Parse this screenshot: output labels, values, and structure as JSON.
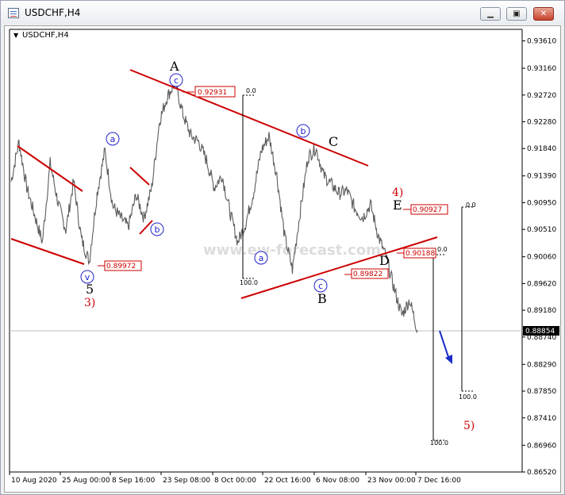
{
  "window": {
    "title": "USDCHF,H4"
  },
  "colors": {
    "wave_line": "#cc0000",
    "label_box": "#cc0000",
    "circle": "#2222cc",
    "arrow": "#1a2ec8",
    "price_series": "#5c5c5c"
  },
  "chart_data": {
    "type": "line",
    "title": "USDCHF,H4",
    "watermark": "www.ew-forecast.com",
    "ylim": [
      0.8652,
      0.938
    ],
    "y_ticks": [
      "0.93610",
      "0.93160",
      "0.92720",
      "0.92280",
      "0.91840",
      "0.91390",
      "0.90950",
      "0.90510",
      "0.90060",
      "0.89620",
      "0.89180",
      "0.88740",
      "0.88290",
      "0.87850",
      "0.87410",
      "0.86960",
      "0.86520"
    ],
    "x_ticks": [
      "10 Aug 2020",
      "25 Aug 00:00",
      "8 Sep 16:00",
      "23 Sep 08:00",
      "8 Oct 00:00",
      "22 Oct 16:00",
      "6 Nov 08:00",
      "23 Nov 00:00",
      "7 Dec 16:00"
    ],
    "current_price": "0.88854",
    "series": [
      {
        "values": [
          {
            "x": "10 Aug 2020",
            "y": 0.913
          },
          {
            "x": "12 Aug",
            "y": 0.9195
          },
          {
            "x": "14 Aug",
            "y": 0.912
          },
          {
            "x": "17 Aug",
            "y": 0.9075
          },
          {
            "x": "19 Aug",
            "y": 0.903
          },
          {
            "x": "21 Aug",
            "y": 0.916
          },
          {
            "x": "24 Aug",
            "y": 0.9095
          },
          {
            "x": "25 Aug 00:00",
            "y": 0.905
          },
          {
            "x": "27 Aug",
            "y": 0.913
          },
          {
            "x": "29 Aug",
            "y": 0.9035
          },
          {
            "x": "31 Aug",
            "y": 0.8998
          },
          {
            "x": "2 Sep",
            "y": 0.911
          },
          {
            "x": "4 Sep",
            "y": 0.918
          },
          {
            "x": "6 Sep",
            "y": 0.909
          },
          {
            "x": "8 Sep 16:00",
            "y": 0.907
          },
          {
            "x": "10 Sep",
            "y": 0.9055
          },
          {
            "x": "12 Sep",
            "y": 0.9108
          },
          {
            "x": "15 Sep",
            "y": 0.907
          },
          {
            "x": "17 Sep",
            "y": 0.912
          },
          {
            "x": "20 Sep",
            "y": 0.923
          },
          {
            "x": "22 Sep",
            "y": 0.927
          },
          {
            "x": "23 Sep 08:00",
            "y": 0.9292
          },
          {
            "x": "25 Sep",
            "y": 0.924
          },
          {
            "x": "28 Sep",
            "y": 0.9205
          },
          {
            "x": "30 Sep",
            "y": 0.9195
          },
          {
            "x": "2 Oct",
            "y": 0.9165
          },
          {
            "x": "5 Oct",
            "y": 0.912
          },
          {
            "x": "8 Oct 00:00",
            "y": 0.914
          },
          {
            "x": "10 Oct",
            "y": 0.908
          },
          {
            "x": "13 Oct",
            "y": 0.903
          },
          {
            "x": "15 Oct",
            "y": 0.906
          },
          {
            "x": "18 Oct",
            "y": 0.911
          },
          {
            "x": "20 Oct",
            "y": 0.918
          },
          {
            "x": "22 Oct 16:00",
            "y": 0.9205
          },
          {
            "x": "25 Oct",
            "y": 0.914
          },
          {
            "x": "28 Oct",
            "y": 0.904
          },
          {
            "x": "1 Nov",
            "y": 0.8985
          },
          {
            "x": "3 Nov",
            "y": 0.908
          },
          {
            "x": "5 Nov",
            "y": 0.917
          },
          {
            "x": "6 Nov 08:00",
            "y": 0.9185
          },
          {
            "x": "10 Nov",
            "y": 0.914
          },
          {
            "x": "13 Nov",
            "y": 0.9125
          },
          {
            "x": "17 Nov",
            "y": 0.911
          },
          {
            "x": "20 Nov",
            "y": 0.9115
          },
          {
            "x": "23 Nov 00:00",
            "y": 0.9085
          },
          {
            "x": "25 Nov",
            "y": 0.907
          },
          {
            "x": "27 Nov",
            "y": 0.9092
          },
          {
            "x": "30 Nov",
            "y": 0.904
          },
          {
            "x": "2 Dec",
            "y": 0.9005
          },
          {
            "x": "3 Dec",
            "y": 0.8955
          },
          {
            "x": "4 Dec",
            "y": 0.891
          },
          {
            "x": "5 Dec",
            "y": 0.8935
          },
          {
            "x": "6 Dec",
            "y": 0.8885
          }
        ]
      }
    ],
    "annotations": {
      "price_boxes": [
        "0.92931",
        "0.89972",
        "0.89822",
        "0.90927",
        "0.90188"
      ],
      "wave_labels": [
        "A",
        "B",
        "C",
        "D",
        "E",
        "5",
        "3)",
        "4)",
        "5)"
      ],
      "circle_labels": [
        "c",
        "a",
        "b",
        "a",
        "b",
        "c",
        "v"
      ],
      "fib_labels": [
        "0.0",
        "100.0",
        "0.0",
        "100.0",
        "0.0",
        "100.0"
      ]
    },
    "grid": false,
    "legend": "none"
  }
}
